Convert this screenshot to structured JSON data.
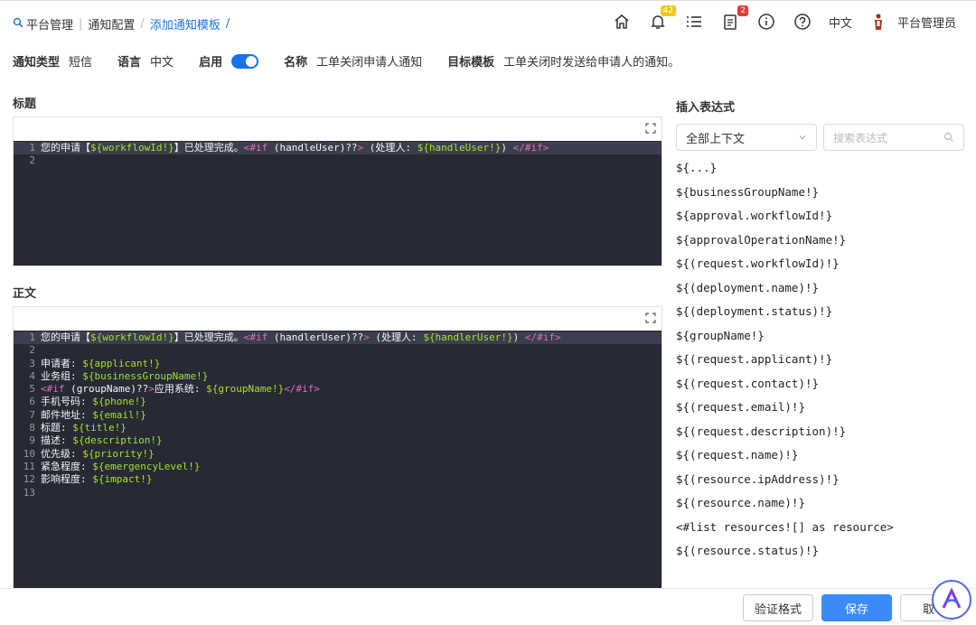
{
  "breadcrumb": {
    "items": [
      "平台管理",
      "通知配置",
      "添加通知模板"
    ],
    "trailing_sep": "/"
  },
  "header": {
    "notification_count": "42",
    "task_count": "2",
    "language": "中文",
    "user": "平台管理员"
  },
  "meta": {
    "type_label": "通知类型",
    "type_value": "短信",
    "lang_label": "语言",
    "lang_value": "中文",
    "enable_label": "启用",
    "enabled": true,
    "name_label": "名称",
    "name_value": "工单关闭申请人通知",
    "target_label": "目标模板",
    "target_value": "工单关闭时发送给申请人的通知。"
  },
  "title_section": {
    "label": "标题",
    "lines": [
      [
        [
          "tx",
          "您的申请【"
        ],
        [
          "var",
          "${workflowId!}"
        ],
        [
          "tx",
          "】已处理完成。"
        ],
        [
          "kw",
          "<#if "
        ],
        [
          "op",
          "(handleUser)??"
        ],
        [
          "kw",
          ">"
        ],
        [
          "tx",
          " (处理人: "
        ],
        [
          "var",
          "${handleUser!}"
        ],
        [
          "tx",
          ") "
        ],
        [
          "kw",
          "</#if>"
        ]
      ],
      []
    ]
  },
  "body_section": {
    "label": "正文",
    "lines": [
      [
        [
          "tx",
          "您的申请【"
        ],
        [
          "var",
          "${workflowId!}"
        ],
        [
          "tx",
          "】已处理完成。"
        ],
        [
          "kw",
          "<#if "
        ],
        [
          "op",
          "(handlerUser)??"
        ],
        [
          "kw",
          ">"
        ],
        [
          "tx",
          " (处理人: "
        ],
        [
          "var",
          "${handlerUser!}"
        ],
        [
          "tx",
          ") "
        ],
        [
          "kw",
          "</#if>"
        ]
      ],
      [],
      [
        [
          "tx",
          "申请者: "
        ],
        [
          "var",
          "${applicant!}"
        ]
      ],
      [
        [
          "tx",
          "业务组: "
        ],
        [
          "var",
          "${businessGroupName!}"
        ]
      ],
      [
        [
          "kw",
          "<#if "
        ],
        [
          "op",
          "(groupName)??"
        ],
        [
          "kw",
          ">"
        ],
        [
          "tx",
          "应用系统: "
        ],
        [
          "var",
          "${groupName!}"
        ],
        [
          "kw",
          "</#if>"
        ]
      ],
      [
        [
          "tx",
          "手机号码: "
        ],
        [
          "var",
          "${phone!}"
        ]
      ],
      [
        [
          "tx",
          "邮件地址: "
        ],
        [
          "var",
          "${email!}"
        ]
      ],
      [
        [
          "tx",
          "标题: "
        ],
        [
          "var",
          "${title!}"
        ]
      ],
      [
        [
          "tx",
          "描述: "
        ],
        [
          "var",
          "${description!}"
        ]
      ],
      [
        [
          "tx",
          "优先级: "
        ],
        [
          "var",
          "${priority!}"
        ]
      ],
      [
        [
          "tx",
          "紧急程度: "
        ],
        [
          "var",
          "${emergencyLevel!}"
        ]
      ],
      [
        [
          "tx",
          "影响程度: "
        ],
        [
          "var",
          "${impact!}"
        ]
      ],
      []
    ]
  },
  "expressions": {
    "title": "插入表达式",
    "context_select": "全部上下文",
    "search_placeholder": "搜索表达式",
    "items": [
      "${...}",
      "${businessGroupName!}",
      "${approval.workflowId!}",
      "${approvalOperationName!}",
      "${(request.workflowId)!}",
      "${(deployment.name)!}",
      "${(deployment.status)!}",
      "${groupName!}",
      "${(request.applicant)!}",
      "${(request.contact)!}",
      "${(request.email)!}",
      "${(request.description)!}",
      "${(request.name)!}",
      "${(resource.ipAddress)!}",
      "${(resource.name)!}",
      "<#list resources![] as resource>",
      "${(resource.status)!}"
    ]
  },
  "footer": {
    "validate": "验证格式",
    "save": "保存",
    "cancel": "取"
  }
}
